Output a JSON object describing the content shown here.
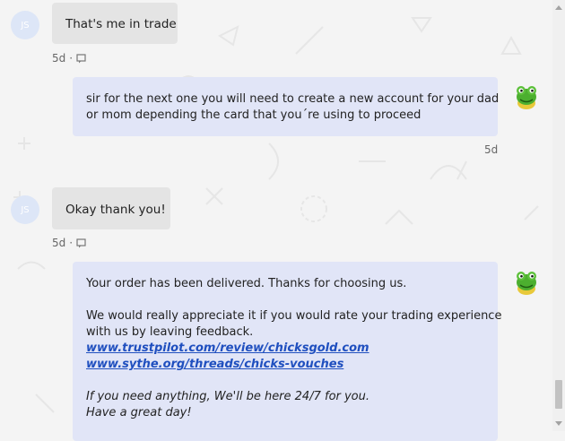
{
  "conversation": {
    "messages": [
      {
        "sender": "customer",
        "avatar_initials": "JS",
        "text": "That's me in trade",
        "time": "5d"
      },
      {
        "sender": "agent",
        "lines": [
          "sir for the next one you will need to create a new account for your dad",
          "or mom depending the card that you´re using to proceed"
        ],
        "time": "5d"
      },
      {
        "sender": "customer",
        "avatar_initials": "JS",
        "text": "Okay thank you!",
        "time": "5d"
      },
      {
        "sender": "agent",
        "intro": "Your order has been delivered. Thanks for choosing us.",
        "request_lines": [
          "We would really appreciate it if you would rate your trading experience",
          "with us by leaving feedback."
        ],
        "links": [
          "www.trustpilot.com/review/chicksgold.com",
          "www.sythe.org/threads/chicks-vouches"
        ],
        "closing_lines": [
          "If you need anything, We'll be here 24/7 for you.",
          "Have a great day!"
        ]
      }
    ]
  },
  "icons": {
    "agent_avatar": "frog-mascot-icon",
    "message_status": "message-icon"
  },
  "colors": {
    "incoming_bubble": "#e4e4e4",
    "outgoing_bubble": "#e1e5f7",
    "avatar_bg": "#dde6f7",
    "link": "#1f4fbf",
    "background": "#f4f4f4"
  }
}
